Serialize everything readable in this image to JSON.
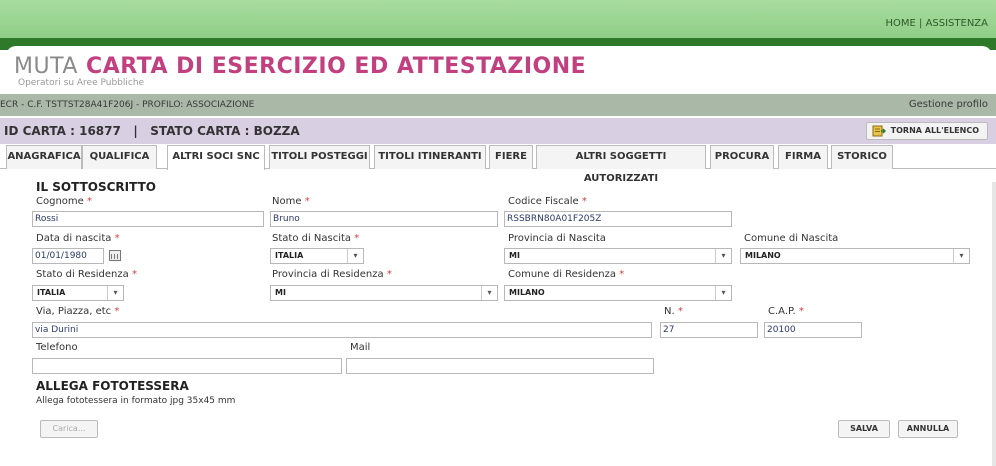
{
  "header": {
    "links": {
      "home": "HOME",
      "separator": "|",
      "help": "ASSISTENZA"
    },
    "title_prefix": "MUTA",
    "title": "CARTA DI ESERCIZIO ED ATTESTAZIONE",
    "subtitle": "Operatori su Aree Pubbliche"
  },
  "status": {
    "user_info": "ECR - C.F. TSTTST28A41F206J - PROFILO: ASSOCIAZIONE",
    "profile_link": "Gestione profilo"
  },
  "card": {
    "info": "ID CARTA : 16877   |   STATO CARTA : BOZZA",
    "back_label": "TORNA ALL'ELENCO"
  },
  "tabs": [
    {
      "label": "ANAGRAFICA"
    },
    {
      "label": "QUALIFICA"
    },
    {
      "label": "ALTRI SOCI SNC"
    },
    {
      "label": "TITOLI POSTEGGI"
    },
    {
      "label": "TITOLI ITINERANTI"
    },
    {
      "label": "FIERE"
    },
    {
      "label": "ALTRI SOGGETTI AUTORIZZATI"
    },
    {
      "label": "PROCURA"
    },
    {
      "label": "FIRMA"
    },
    {
      "label": "STORICO"
    }
  ],
  "active_tab": "ALTRI SOCI SNC",
  "form": {
    "section_title": "IL SOTTOSCRITTO",
    "required_mark": "*",
    "cognome": {
      "label": "Cognome",
      "value": "Rossi"
    },
    "nome": {
      "label": "Nome",
      "value": "Bruno"
    },
    "codice_fiscale": {
      "label": "Codice Fiscale",
      "value": "RSSBRN80A01F205Z"
    },
    "data_nascita": {
      "label": "Data di nascita",
      "value": "01/01/1980"
    },
    "stato_nascita": {
      "label": "Stato di Nascita",
      "value": "ITALIA"
    },
    "provincia_nascita": {
      "label": "Provincia di Nascita",
      "value": "MI"
    },
    "comune_nascita": {
      "label": "Comune di Nascita",
      "value": "MILANO"
    },
    "stato_residenza": {
      "label": "Stato di Residenza",
      "value": "ITALIA"
    },
    "provincia_residenza": {
      "label": "Provincia di Residenza",
      "value": "MI"
    },
    "comune_residenza": {
      "label": "Comune di Residenza",
      "value": "MILANO"
    },
    "via": {
      "label": "Via, Piazza, etc",
      "value": "via Durini"
    },
    "numero": {
      "label": "N.",
      "value": "27"
    },
    "cap": {
      "label": "C.A.P.",
      "value": "20100"
    },
    "telefono": {
      "label": "Telefono",
      "value": ""
    },
    "mail": {
      "label": "Mail",
      "value": ""
    }
  },
  "attachment": {
    "title": "ALLEGA FOTOTESSERA",
    "note": "Allega fototessera in formato jpg 35x45 mm",
    "upload_label": "Carica..."
  },
  "actions": {
    "save": "SALVA",
    "cancel": "ANNULLA"
  },
  "colors": {
    "accent_pink": "#c2407f",
    "header_green": "#2e7a2a",
    "required_red": "#d04040",
    "card_bar": "#d8cfe2"
  }
}
